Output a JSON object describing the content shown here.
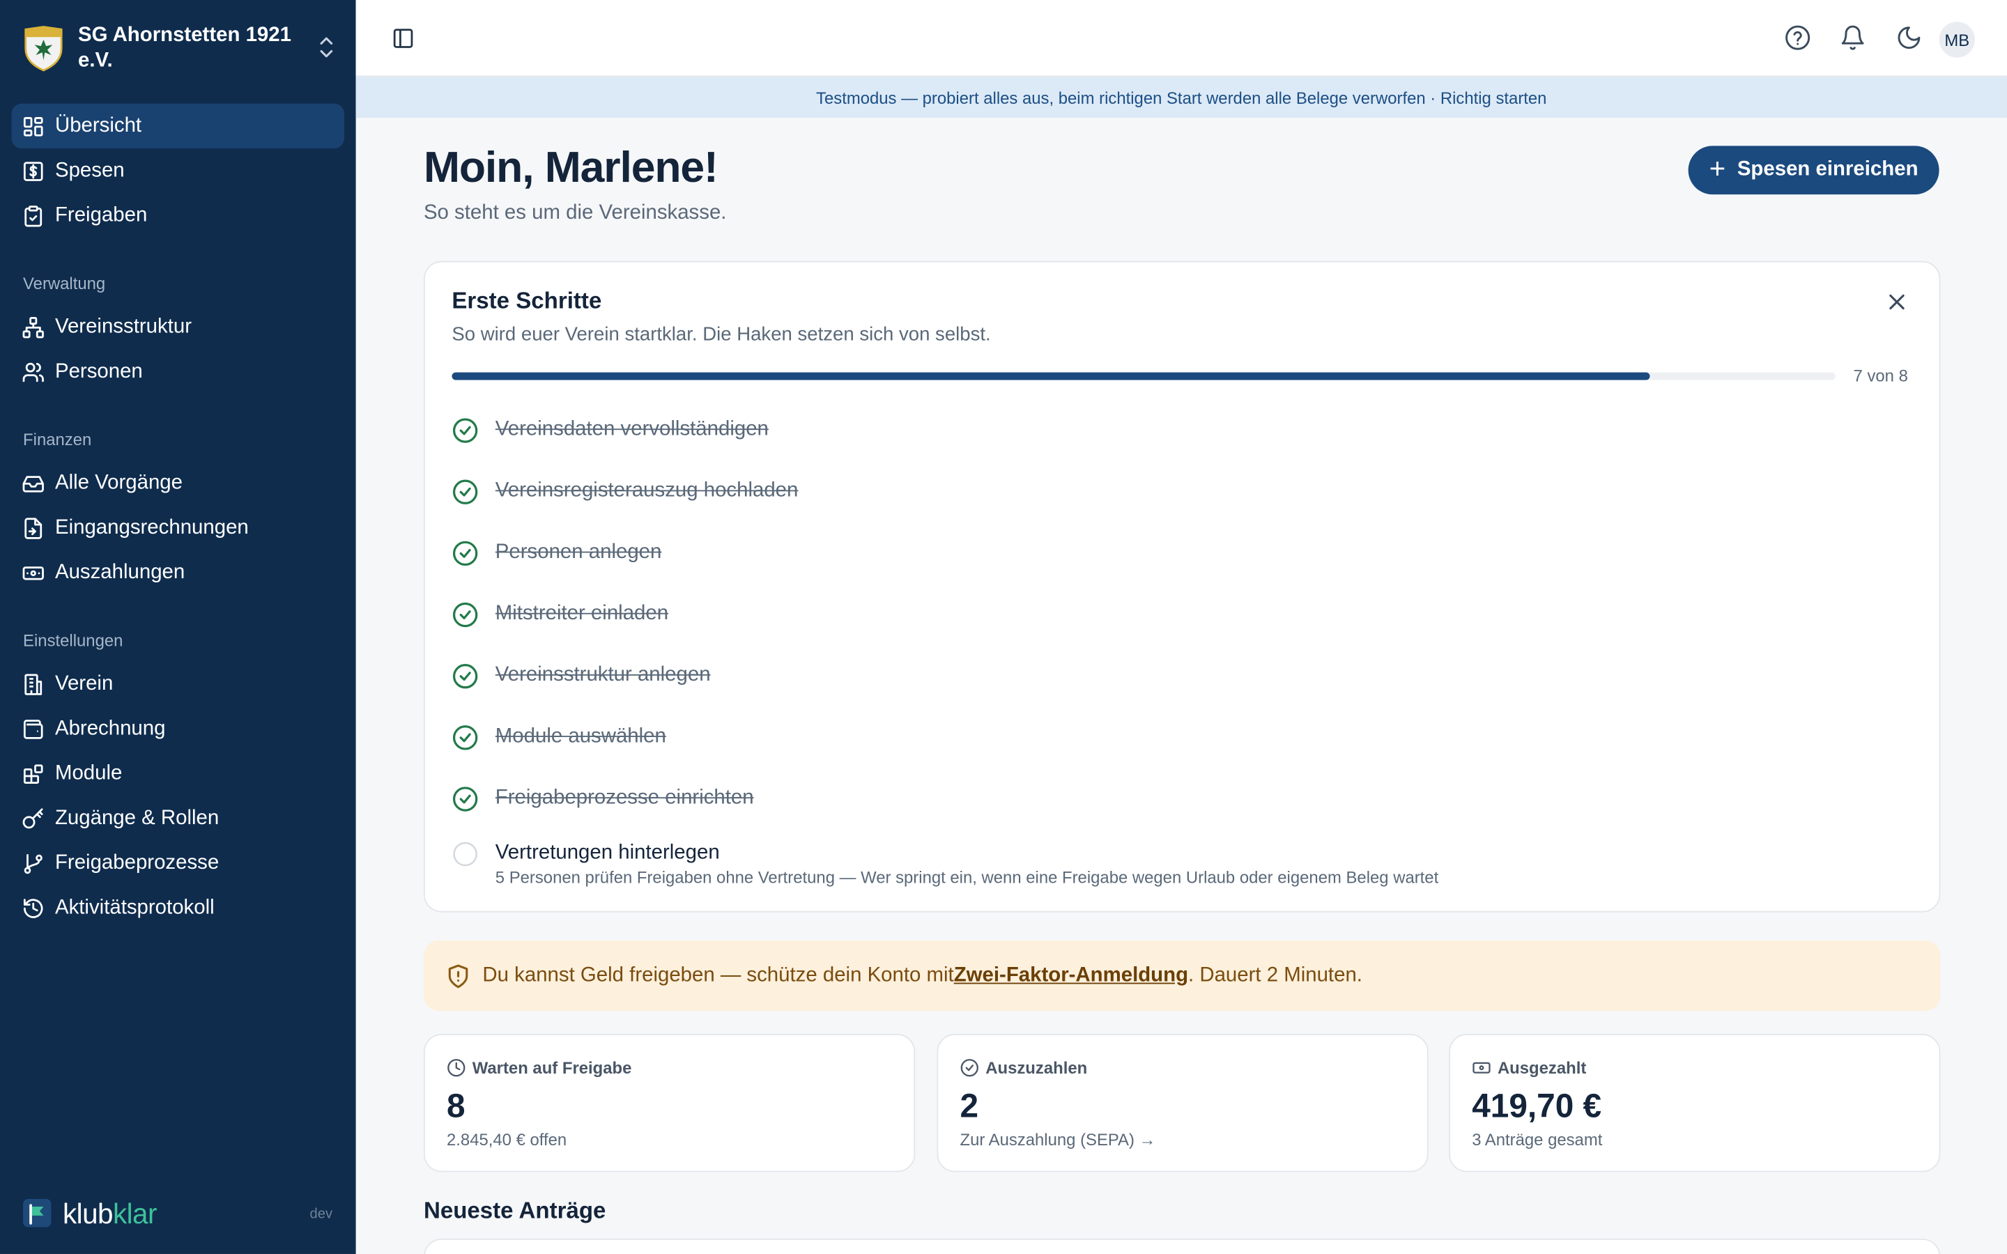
{
  "org": {
    "name": "SG Ahornstetten 1921 e.V."
  },
  "nav": {
    "main": [
      {
        "label": "Übersicht",
        "icon": "dashboard-icon",
        "active": true
      },
      {
        "label": "Spesen",
        "icon": "receipt-icon"
      },
      {
        "label": "Freigaben",
        "icon": "clipboard-check-icon"
      }
    ],
    "sections": [
      {
        "title": "Verwaltung",
        "items": [
          {
            "label": "Vereinsstruktur",
            "icon": "org-chart-icon"
          },
          {
            "label": "Personen",
            "icon": "users-icon"
          }
        ]
      },
      {
        "title": "Finanzen",
        "items": [
          {
            "label": "Alle Vorgänge",
            "icon": "inbox-icon"
          },
          {
            "label": "Eingangsrechnungen",
            "icon": "file-import-icon"
          },
          {
            "label": "Auszahlungen",
            "icon": "banknote-icon"
          }
        ]
      },
      {
        "title": "Einstellungen",
        "items": [
          {
            "label": "Verein",
            "icon": "building-icon"
          },
          {
            "label": "Abrechnung",
            "icon": "wallet-icon"
          },
          {
            "label": "Module",
            "icon": "blocks-icon"
          },
          {
            "label": "Zugänge & Rollen",
            "icon": "key-icon"
          },
          {
            "label": "Freigabeprozesse",
            "icon": "git-branch-icon"
          },
          {
            "label": "Aktivitätsprotokoll",
            "icon": "history-icon"
          }
        ]
      }
    ]
  },
  "brand": {
    "name_a": "klub",
    "name_b": "klar",
    "env": "dev"
  },
  "topbar": {
    "avatar": "MB"
  },
  "banner": {
    "text": "Testmodus — probiert alles aus, beim richtigen Start werden alle Belege verworfen · Richtig starten"
  },
  "main": {
    "greeting": "Moin, Marlene!",
    "subtitle": "So steht es um die Vereinskasse.",
    "primary_button": "Spesen einreichen"
  },
  "steps": {
    "title": "Erste Schritte",
    "subtitle": "So wird euer Verein startklar. Die Haken setzen sich von selbst.",
    "progress_done": 7,
    "progress_total": 8,
    "progress_label": "7 von 8",
    "items": [
      {
        "label": "Vereinsdaten vervollständigen",
        "done": true
      },
      {
        "label": "Vereinsregisterauszug hochladen",
        "done": true
      },
      {
        "label": "Personen anlegen",
        "done": true
      },
      {
        "label": "Mitstreiter einladen",
        "done": true
      },
      {
        "label": "Vereinsstruktur anlegen",
        "done": true
      },
      {
        "label": "Module auswählen",
        "done": true
      },
      {
        "label": "Freigabeprozesse einrichten",
        "done": true
      },
      {
        "label": "Vertretungen hinterlegen",
        "done": false
      }
    ],
    "open_desc": "5 Personen prüfen Freigaben ohne Vertretung — Wer springt ein, wenn eine Freigabe wegen Urlaub oder eigenem Beleg wartet"
  },
  "security": {
    "before": "Du kannst Geld freigeben — schütze dein Konto mit ",
    "link": "Zwei-Faktor-Anmeldung",
    "after": ". Dauert 2 Minuten."
  },
  "stats": [
    {
      "title": "Warten auf Freigabe",
      "value": "8",
      "foot": "2.845,40 € offen",
      "icon": "clock-icon"
    },
    {
      "title": "Auszuzahlen",
      "value": "2",
      "foot": "Zur Auszahlung (SEPA) →",
      "icon": "check-circle-icon"
    },
    {
      "title": "Ausgezahlt",
      "value": "419,70 €",
      "foot": "3 Anträge gesamt",
      "icon": "banknote-icon"
    }
  ],
  "recent": {
    "title": "Neueste Anträge"
  },
  "colors": {
    "sidebar": "#0f2c4d",
    "accent": "#1b4a7e",
    "success": "#237a4a",
    "warning_bg": "#fdf0dc"
  }
}
